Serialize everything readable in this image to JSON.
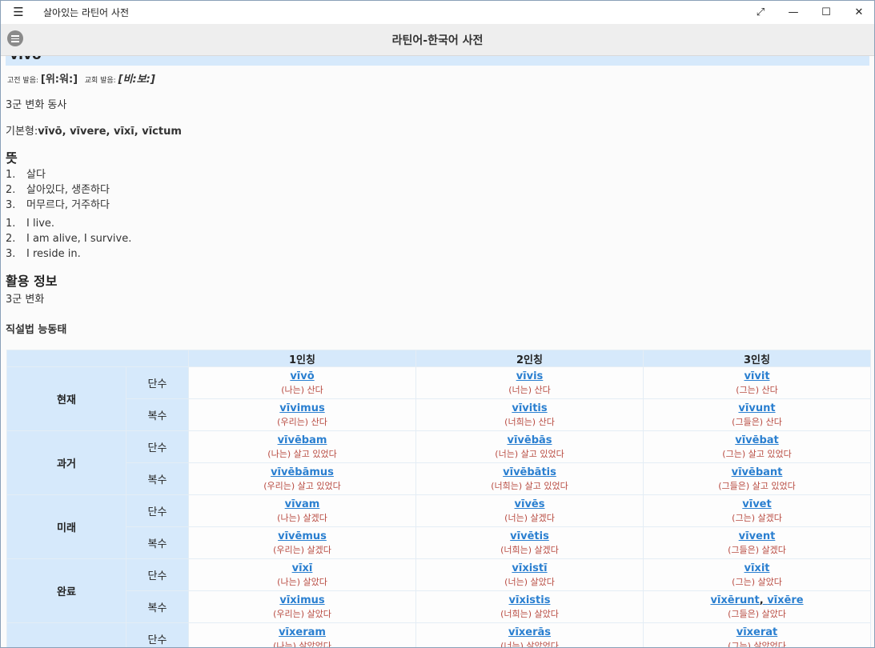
{
  "window": {
    "title": "살아있는 라틴어 사전",
    "menu_icon": "☰",
    "restore_icon": "⤢",
    "minimize_icon": "—",
    "maximize_icon": "☐",
    "close_icon": "✕"
  },
  "header": {
    "title": "라틴어-한국어 사전"
  },
  "entry": {
    "word": "vīvō",
    "pron_classic_label": "고전 발음:",
    "pron_classic": "[위:워:]",
    "pron_church_label": "교회 발음:",
    "pron_church": "[비:보:]",
    "class": "3군 변화 동사",
    "principal_label": "기본형:",
    "principal_parts": "vīvō, vīvere, vīxī, vīctum",
    "meaning_heading": "뜻",
    "meanings_ko": [
      "살다",
      "살아있다, 생존하다",
      "머무르다, 거주하다"
    ],
    "meanings_en": [
      "I live.",
      "I am alive, I survive.",
      "I reside in."
    ],
    "conj_heading": "활용 정보",
    "conj_class": "3군 변화",
    "mood_heading": "직설법 능동태"
  },
  "table": {
    "headers": [
      "",
      "1인칭",
      "2인칭",
      "3인칭"
    ],
    "number_labels": {
      "sg": "단수",
      "pl": "복수"
    },
    "tenses": [
      {
        "name": "현재",
        "sg": [
          {
            "lat": "vīvō",
            "ko": "(나는) 산다"
          },
          {
            "lat": "vīvis",
            "ko": "(너는) 산다"
          },
          {
            "lat": "vīvit",
            "ko": "(그는) 산다"
          }
        ],
        "pl": [
          {
            "lat": "vīvimus",
            "ko": "(우리는) 산다"
          },
          {
            "lat": "vīvitis",
            "ko": "(너희는) 산다"
          },
          {
            "lat": "vīvunt",
            "ko": "(그들은) 산다"
          }
        ]
      },
      {
        "name": "과거",
        "sg": [
          {
            "lat": "vīvēbam",
            "ko": "(나는) 살고 있었다"
          },
          {
            "lat": "vīvēbās",
            "ko": "(너는) 살고 있었다"
          },
          {
            "lat": "vīvēbat",
            "ko": "(그는) 살고 있었다"
          }
        ],
        "pl": [
          {
            "lat": "vīvēbāmus",
            "ko": "(우리는) 살고 있었다"
          },
          {
            "lat": "vīvēbātis",
            "ko": "(너희는) 살고 있었다"
          },
          {
            "lat": "vīvēbant",
            "ko": "(그들은) 살고 있었다"
          }
        ]
      },
      {
        "name": "미래",
        "sg": [
          {
            "lat": "vīvam",
            "ko": "(나는) 살겠다"
          },
          {
            "lat": "vīvēs",
            "ko": "(너는) 살겠다"
          },
          {
            "lat": "vīvet",
            "ko": "(그는) 살겠다"
          }
        ],
        "pl": [
          {
            "lat": "vīvēmus",
            "ko": "(우리는) 살겠다"
          },
          {
            "lat": "vīvētis",
            "ko": "(너희는) 살겠다"
          },
          {
            "lat": "vīvent",
            "ko": "(그들은) 살겠다"
          }
        ]
      },
      {
        "name": "완료",
        "sg": [
          {
            "lat": "vīxī",
            "ko": "(나는) 살았다"
          },
          {
            "lat": "vīxistī",
            "ko": "(너는) 살았다"
          },
          {
            "lat": "vīxit",
            "ko": "(그는) 살았다"
          }
        ],
        "pl": [
          {
            "lat": "vīximus",
            "ko": "(우리는) 살았다"
          },
          {
            "lat": "vīxistis",
            "ko": "(너희는) 살았다"
          },
          {
            "lat": "vīxērunt",
            "lat2": "vīxēre",
            "sep": ", ",
            "ko": "(그들은) 살았다"
          }
        ]
      },
      {
        "name": "",
        "sg": [
          {
            "lat": "vīxeram",
            "ko": "(나는) 살았었다"
          },
          {
            "lat": "vīxerās",
            "ko": "(너는) 살았었다"
          },
          {
            "lat": "vīxerat",
            "ko": "(그는) 살았었다"
          }
        ]
      }
    ]
  }
}
